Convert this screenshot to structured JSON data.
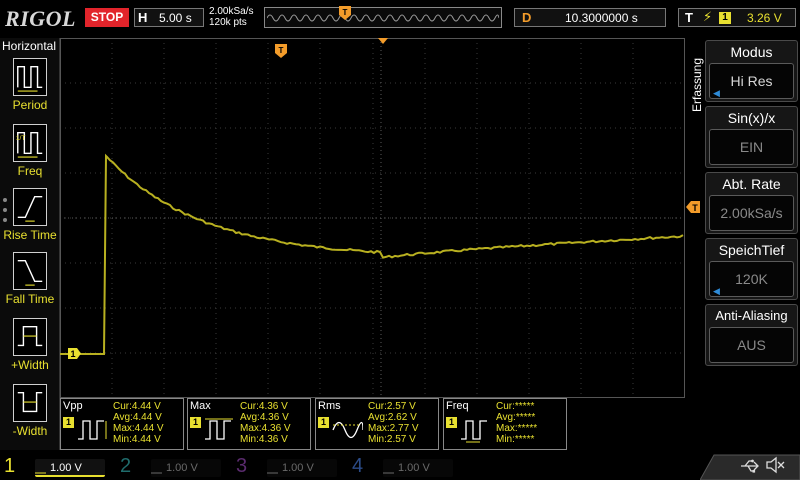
{
  "brand": "RIGOL",
  "status": "STOP",
  "timebase": {
    "letter": "H",
    "scale": "5.00 s",
    "sample_rate": "2.00kSa/s",
    "points": "120k pts"
  },
  "delay": {
    "letter": "D",
    "value": "10.3000000 s"
  },
  "trigger": {
    "letter": "T",
    "edge_glyph": "⚡",
    "channel": "1",
    "level": "3.26 V"
  },
  "left_menu": {
    "title": "Horizontal",
    "items": [
      {
        "label": "Period"
      },
      {
        "label": "Freq"
      },
      {
        "label": "Rise Time"
      },
      {
        "label": "Fall Time"
      },
      {
        "label": "+Width"
      },
      {
        "label": "-Width"
      }
    ]
  },
  "right_menu": {
    "section": "Erfassung",
    "items": [
      {
        "label": "Modus",
        "value": "Hi Res"
      },
      {
        "label": "Sin(x)/x",
        "value": "EIN"
      },
      {
        "label": "Abt. Rate",
        "value": "2.00kSa/s"
      },
      {
        "label": "SpeichTief",
        "value": "120K"
      },
      {
        "label": "Anti-Aliasing",
        "value": "AUS"
      }
    ]
  },
  "markers": {
    "trigger_position": "T",
    "trigger_level": "T",
    "ch1_ground": "1"
  },
  "measurements": [
    {
      "name": "Vpp",
      "channel": "1",
      "lines": "Cur:4.44 V\nAvg:4.44 V\nMax:4.44 V\nMin:4.44 V"
    },
    {
      "name": "Max",
      "channel": "1",
      "lines": "Cur:4.36 V\nAvg:4.36 V\nMax:4.36 V\nMin:4.36 V"
    },
    {
      "name": "Rms",
      "channel": "1",
      "lines": "Cur:2.57 V\nAvg:2.62 V\nMax:2.77 V\nMin:2.57 V"
    },
    {
      "name": "Freq",
      "channel": "1",
      "lines": "Cur:*****\nAvg:*****\nMax:*****\nMin:*****"
    }
  ],
  "channels": [
    {
      "num": "1",
      "scale": "1.00 V"
    },
    {
      "num": "2",
      "scale": "1.00 V"
    },
    {
      "num": "3",
      "scale": "1.00 V"
    },
    {
      "num": "4",
      "scale": "1.00 V"
    }
  ],
  "colors": {
    "ch1": "#e8e030",
    "trace": "#b8b020",
    "stop": "#e2242b",
    "delay": "#f39c2a",
    "accent": "#2e8bd8"
  }
}
